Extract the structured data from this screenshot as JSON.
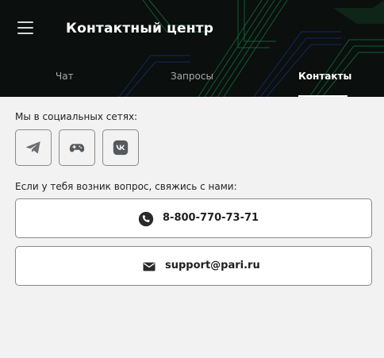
{
  "header": {
    "title": "Контактный центр",
    "tabs": [
      {
        "label": "Чат"
      },
      {
        "label": "Запросы"
      },
      {
        "label": "Контакты"
      }
    ]
  },
  "social": {
    "label": "Мы в социальных сетях:",
    "items": [
      {
        "icon": "telegram-icon"
      },
      {
        "icon": "gamepad-icon"
      },
      {
        "icon": "vk-icon"
      }
    ]
  },
  "contacts": {
    "label": "Если у тебя возник вопрос, свяжись с нами:",
    "phone": "8-800-770-73-71",
    "email": "support@pari.ru"
  },
  "colors": {
    "header_bg": "#0b0f0d",
    "accent_green": "#1ed760",
    "page_bg": "#f2f2f2"
  }
}
